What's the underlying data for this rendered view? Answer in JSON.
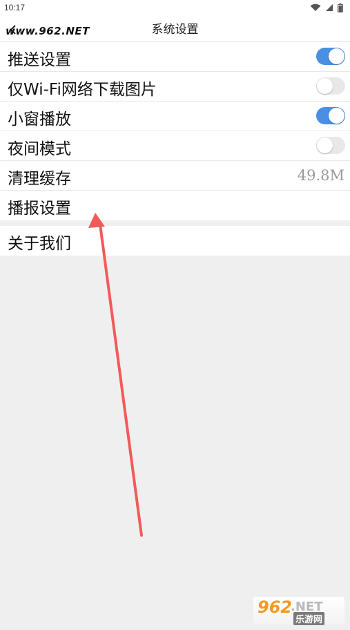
{
  "status_bar": {
    "time": "10:17"
  },
  "watermark": "www.962.NET",
  "header": {
    "title": "系统设置"
  },
  "settings": [
    {
      "label": "推送设置",
      "control": "toggle",
      "on": true
    },
    {
      "label": "仅Wi-Fi网络下载图片",
      "control": "toggle",
      "on": false
    },
    {
      "label": "小窗播放",
      "control": "toggle",
      "on": true
    },
    {
      "label": "夜间模式",
      "control": "toggle",
      "on": false
    },
    {
      "label": "清理缓存",
      "control": "value",
      "value": "49.8M"
    },
    {
      "label": "播报设置",
      "control": "none"
    }
  ],
  "about": {
    "label": "关于我们"
  },
  "logo": {
    "brand": "962",
    "domain": ".NET",
    "cn": "乐游网"
  },
  "colors": {
    "toggle_on": "#4a90e2",
    "arrow": "#f25a5a"
  }
}
